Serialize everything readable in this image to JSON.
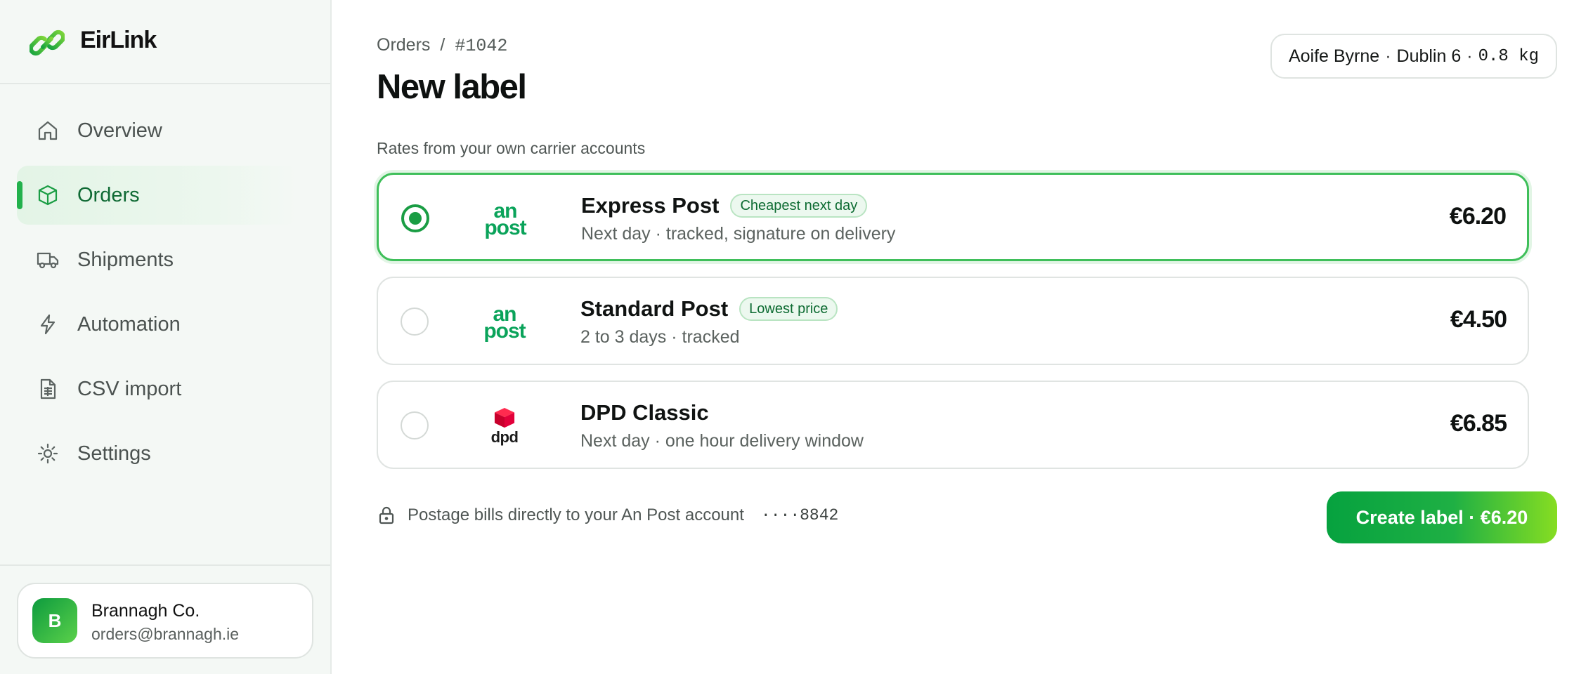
{
  "brand": {
    "name": "EirLink",
    "logo_icon": "chain-link-icon"
  },
  "sidebar": {
    "items": [
      {
        "label": "Overview",
        "icon": "home-icon",
        "active": false
      },
      {
        "label": "Orders",
        "icon": "box-icon",
        "active": true
      },
      {
        "label": "Shipments",
        "icon": "truck-icon",
        "active": false
      },
      {
        "label": "Automation",
        "icon": "lightning-icon",
        "active": false
      },
      {
        "label": "CSV import",
        "icon": "spreadsheet-file-icon",
        "active": false
      },
      {
        "label": "Settings",
        "icon": "gear-icon",
        "active": false
      }
    ],
    "account": {
      "initial": "B",
      "name": "Brannagh Co.",
      "email": "orders@brannagh.ie"
    }
  },
  "header": {
    "breadcrumb": {
      "parent": "Orders",
      "separator": "/",
      "order_id": "#1042"
    },
    "title": "New label",
    "summary": {
      "recipient": "Aoife Byrne",
      "area": "Dublin 6",
      "weight": "0.8 kg",
      "separator": "·"
    }
  },
  "rates": {
    "section_label": "Rates from your own carrier accounts",
    "options": [
      {
        "name": "Express Post",
        "badge": "Cheapest next day",
        "description": "Next day · tracked, signature on delivery",
        "price": "€6.20",
        "carrier_logo": "an-post-logo",
        "logo_text_top": "an",
        "logo_text_bottom": "post",
        "selected": true
      },
      {
        "name": "Standard Post",
        "badge": "Lowest price",
        "description": "2 to 3 days · tracked",
        "price": "€4.50",
        "carrier_logo": "an-post-logo",
        "logo_text_top": "an",
        "logo_text_bottom": "post",
        "selected": false
      },
      {
        "name": "DPD Classic",
        "badge": "",
        "description": "Next day · one hour delivery window",
        "price": "€6.85",
        "carrier_logo": "dpd-logo",
        "logo_text": "dpd",
        "selected": false
      }
    ]
  },
  "footer": {
    "billing_note": "Postage bills directly to your An Post account",
    "account_mask": "····8842",
    "create_button_label": "Create label · €6.20"
  },
  "colors": {
    "accent": "#1a9d44",
    "accent_light": "#ecf8ef",
    "dpd_red": "#dc0032"
  }
}
